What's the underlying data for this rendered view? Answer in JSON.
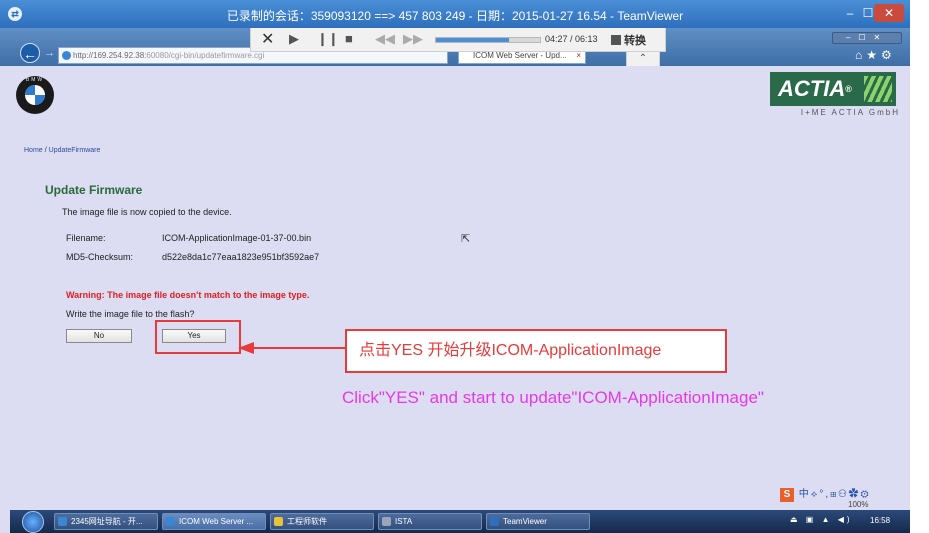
{
  "teamviewer": {
    "title": "已录制的会话：359093120 ==> 457 803 249 - 日期：2015-01-27 16.54 - TeamViewer",
    "minimize": "–",
    "maximize": "☐",
    "close": "✕"
  },
  "browser": {
    "url_prefix": "http://169.254.92.38:",
    "url_rest": "60080/cgi-bin/updatefirmware.cgi",
    "tab_title": "ICOM Web Server - Upd...",
    "tab_close": "×",
    "icons": "⌂★⚙",
    "window_buttons": "–☐✕"
  },
  "media": {
    "close": "✕",
    "play": "▶",
    "pause": "❙❙",
    "stop": "■",
    "rewind": "◀◀",
    "forward": "▶▶",
    "progress_fraction": 0.7,
    "time": "04:27 / 06:13",
    "convert_label": "转换",
    "collapse": "⌃"
  },
  "page": {
    "bmw_text": "BMW",
    "actia_brand": "ACTIA",
    "actia_reg": "®",
    "actia_subtitle": "I+ME ACTIA GmbH",
    "breadcrumb": {
      "home": "Home",
      "sep": "/",
      "current": "UpdateFirmware"
    },
    "title": "Update Firmware",
    "copied_message": "The image file is now copied to the device.",
    "filename_label": "Filename:",
    "filename_value": "ICOM-ApplicationImage-01-37-00.bin",
    "md5_label": "MD5-Checksum:",
    "md5_value": "d522e8da1c77eaa1823e951bf3592ae7",
    "warning": "Warning: The image file doesn't match to the image type.",
    "question": "Write the image file to the flash?",
    "no_label": "No",
    "yes_label": "Yes"
  },
  "annotation": {
    "callout_cn": "点击YES 开始升级ICOM-ApplicationImage",
    "caption_en": "Click\"YES\" and start to update\"ICOM-ApplicationImage\"",
    "highlight_color": "#e83a3a",
    "caption_color": "#e639e6"
  },
  "ime": {
    "logo": "S",
    "icons": "中⟡°,⊞⚇✿⚙",
    "zoom": "100%"
  },
  "taskbar": {
    "items": [
      {
        "label": "2345网址导航 - 开...",
        "icon_color": "#3a86d4"
      },
      {
        "label": "ICOM Web Server ...",
        "icon_color": "#3a86d4"
      },
      {
        "label": "工程师软件",
        "icon_color": "#e8c23a"
      },
      {
        "label": "ISTA",
        "icon_color": "#9aa6b8"
      },
      {
        "label": "TeamViewer",
        "icon_color": "#2f6fbe"
      }
    ],
    "tray": "⏏ ▣ ▲ ◀)",
    "clock": "16:58"
  }
}
